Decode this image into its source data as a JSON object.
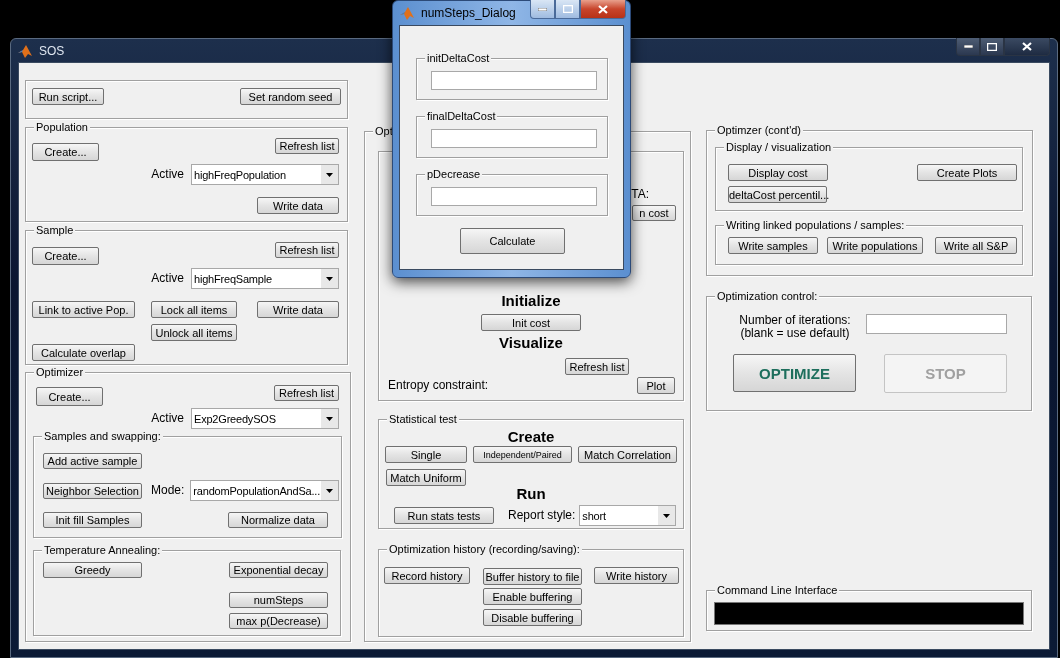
{
  "main_window": {
    "title": "SOS"
  },
  "script_panel": {
    "run_script": "Run script...",
    "set_seed": "Set random seed"
  },
  "population": {
    "title": "Population",
    "create": "Create...",
    "refresh": "Refresh list",
    "active_label": "Active",
    "active_value": "highFreqPopulation",
    "write": "Write data"
  },
  "sample": {
    "title": "Sample",
    "create": "Create...",
    "refresh": "Refresh list",
    "active_label": "Active",
    "active_value": "highFreqSample",
    "link": "Link to active Pop.",
    "lock": "Lock all items",
    "write": "Write data",
    "unlock": "Unlock all items",
    "overlap": "Calculate overlap"
  },
  "optimizer": {
    "title": "Optimizer",
    "create": "Create...",
    "refresh": "Refresh list",
    "active_label": "Active",
    "active_value": "Exp2GreedySOS",
    "samples_swapping": {
      "title": "Samples and swapping:",
      "add_sample": "Add active sample",
      "neighbor": "Neighbor Selection",
      "mode_label": "Mode:",
      "mode_value": "randomPopulationAndSa...",
      "init_fill": "Init fill Samples",
      "normalize": "Normalize data"
    },
    "temperature_annealing": {
      "title": "Temperature Annealing:",
      "greedy": "Greedy",
      "exponential": "Exponential decay",
      "num_steps": "numSteps",
      "max_p": "max p(Decrease)"
    }
  },
  "optimizer_center": {
    "title": "Opt",
    "label_fragment": "TA:",
    "button_fragment": "n cost",
    "initialize_heading": "Initialize",
    "init_cost": "Init cost",
    "visualize_heading": "Visualize",
    "refresh": "Refresh list",
    "entropy_label": "Entropy constraint:",
    "plot": "Plot"
  },
  "statistical_test": {
    "title": "Statistical test",
    "create_heading": "Create",
    "single": "Single",
    "independent_paired": "Independent/Paired",
    "match_correlation": "Match Correlation",
    "match_uniform": "Match Uniform",
    "run_heading": "Run",
    "run_tests": "Run stats tests",
    "report_label": "Report style:",
    "report_value": "short"
  },
  "optimization_history": {
    "title": "Optimization history (recording/saving):",
    "record": "Record history",
    "buffer": "Buffer history to file",
    "write": "Write history",
    "enable": "Enable buffering",
    "disable": "Disable buffering"
  },
  "optimizer_contd": {
    "title": "Optimzer (cont'd)",
    "display": {
      "title": "Display / visualization",
      "display_cost": "Display cost",
      "create_plots": "Create Plots",
      "percentile": "deltaCost percentil..."
    },
    "writing": {
      "title": "Writing linked populations / samples:",
      "buttons": [
        "Write samples",
        "Write populations",
        "Write all S&P"
      ]
    }
  },
  "optimization_control": {
    "title": "Optimization control:",
    "iterations_label": "Number of iterations:",
    "iterations_note": "(blank = use default)",
    "optimize": {
      "label": "OPTIMIZE",
      "disabled": false
    },
    "stop": {
      "label": "STOP",
      "disabled": true
    }
  },
  "command_line": {
    "title": "Command Line Interface"
  },
  "dialog": {
    "title": "numSteps_Dialog",
    "fields": [
      {
        "label": "initDeltaCost"
      },
      {
        "label": "finalDeltaCost"
      },
      {
        "label": "pDecrease"
      }
    ],
    "calculate": "Calculate"
  }
}
